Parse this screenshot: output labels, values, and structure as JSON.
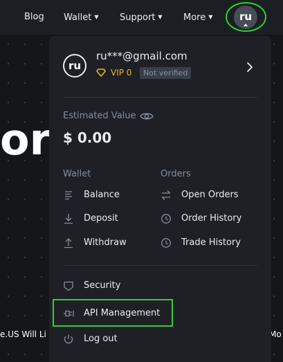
{
  "background": {
    "hero_fragment": "or",
    "ticker_left": "e.US Will Li",
    "ticker_right": "Mo"
  },
  "nav": {
    "blog": "Blog",
    "wallet": "Wallet",
    "support": "Support",
    "more": "More",
    "avatar_initials": "ru"
  },
  "account": {
    "avatar_initials": "ru",
    "email": "ru***@gmail.com",
    "vip_level": "VIP 0",
    "verification_status": "Not verified"
  },
  "balance": {
    "label": "Estimated Value",
    "value": "$ 0.00"
  },
  "wallet_menu": {
    "heading": "Wallet",
    "items": [
      {
        "label": "Balance",
        "icon": "balance-icon"
      },
      {
        "label": "Deposit",
        "icon": "deposit-icon"
      },
      {
        "label": "Withdraw",
        "icon": "withdraw-icon"
      }
    ]
  },
  "orders_menu": {
    "heading": "Orders",
    "items": [
      {
        "label": "Open Orders",
        "icon": "open-orders-icon"
      },
      {
        "label": "Order History",
        "icon": "clock-icon"
      },
      {
        "label": "Trade History",
        "icon": "clock-icon"
      }
    ]
  },
  "account_menu": [
    {
      "label": "Security",
      "icon": "shield-icon"
    },
    {
      "label": "API Management",
      "icon": "api-key-icon"
    },
    {
      "label": "Log out",
      "icon": "power-icon"
    }
  ],
  "colors": {
    "accent": "#F0B90B",
    "highlight": "#2FD22F",
    "panel": "#1E2026",
    "muted_text": "#848E9C"
  }
}
